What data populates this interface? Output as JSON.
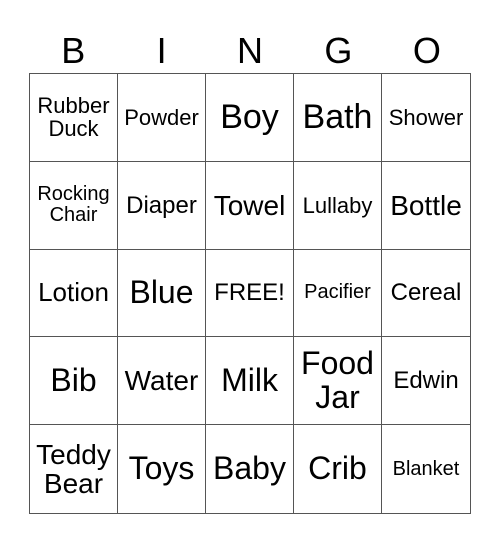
{
  "header": {
    "letters": [
      "B",
      "I",
      "N",
      "G",
      "O"
    ]
  },
  "cells": [
    "Rubber Duck",
    "Powder",
    "Boy",
    "Bath",
    "Shower",
    "Rocking Chair",
    "Diaper",
    "Towel",
    "Lullaby",
    "Bottle",
    "Lotion",
    "Blue",
    "FREE!",
    "Pacifier",
    "Cereal",
    "Bib",
    "Water",
    "Milk",
    "Food Jar",
    "Edwin",
    "Teddy Bear",
    "Toys",
    "Baby",
    "Crib",
    "Blanket"
  ]
}
